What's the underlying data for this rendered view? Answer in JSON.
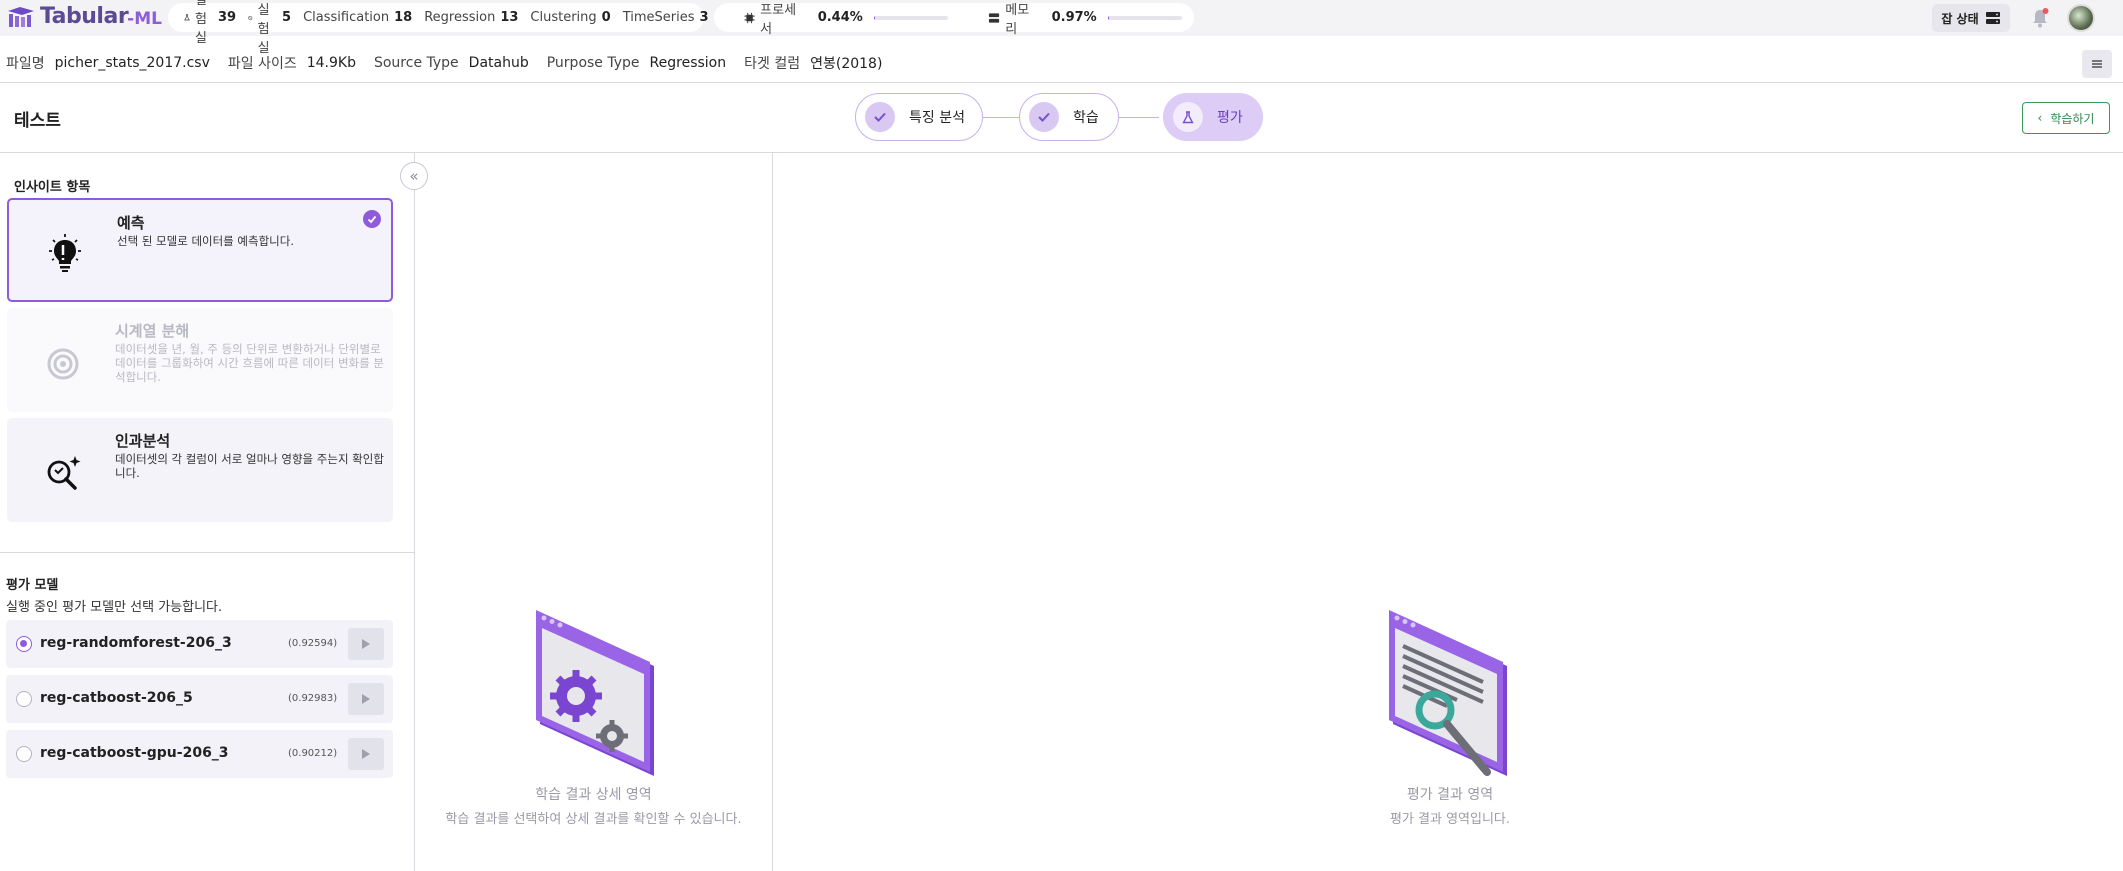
{
  "app": {
    "logo_text": "Tabular",
    "logo_sub": "-ML"
  },
  "stats": {
    "experiments_label": "실험실",
    "experiments_count": "39",
    "empty_label": "빈 실험실",
    "empty_count": "5",
    "classification_label": "Classification",
    "classification_count": "18",
    "regression_label": "Regression",
    "regression_count": "13",
    "clustering_label": "Clustering",
    "clustering_count": "0",
    "timeseries_label": "TimeSeries",
    "timeseries_count": "3"
  },
  "resources": {
    "cpu_label": "프로세서",
    "cpu_value": "0.44%",
    "cpu_fraction": 0.0044,
    "mem_label": "메모리",
    "mem_value": "0.97%",
    "mem_fraction": 0.0097
  },
  "header_right": {
    "job_status_label": "잡 상태"
  },
  "info": {
    "file_name_key": "파일명",
    "file_name": "picher_stats_2017.csv",
    "file_size_key": "파일 사이즈",
    "file_size": "14.9Kb",
    "source_type_key": "Source Type",
    "source_type": "Datahub",
    "purpose_type_key": "Purpose Type",
    "purpose_type": "Regression",
    "target_key": "타겟 컬럼",
    "target": "연봉(2018)"
  },
  "page": {
    "title": "테스트",
    "back_label": "학습하기"
  },
  "steps": [
    {
      "label": "특징 분석"
    },
    {
      "label": "학습"
    },
    {
      "label": "평가"
    }
  ],
  "insights": {
    "section_title": "인사이트 항목",
    "cards": [
      {
        "title": "예측",
        "desc": "선택 된 모델로 데이터를 예측합니다."
      },
      {
        "title": "시계열 분해",
        "desc": "데이터셋을 년, 월, 주 등의 단위로 변환하거나 단위별로 데이터를 그룹화하여 시간 흐름에 따른 데이터 변화를 분석합니다."
      },
      {
        "title": "인과분석",
        "desc": "데이터셋의 각 컬럼이 서로 얼마나 영향을 주는지 확인합니다."
      }
    ]
  },
  "models": {
    "title": "평가 모델",
    "subtitle": "실행 중인 평가 모델만 선택 가능합니다.",
    "items": [
      {
        "name": "reg-randomforest-206_3",
        "score": "(0.92594)",
        "selected": true
      },
      {
        "name": "reg-catboost-206_5",
        "score": "(0.92983)",
        "selected": false
      },
      {
        "name": "reg-catboost-gpu-206_3",
        "score": "(0.90212)",
        "selected": false
      }
    ]
  },
  "placeholders": {
    "train_title": "학습 결과 상세 영역",
    "train_sub": "학습 결과를 선택하여 상세 결과를 확인할 수 있습니다.",
    "eval_title": "평가 결과 영역",
    "eval_sub": "평가 결과 영역입니다."
  },
  "colors": {
    "accent": "#8e5bdc",
    "back_button": "#2f8a4e"
  }
}
